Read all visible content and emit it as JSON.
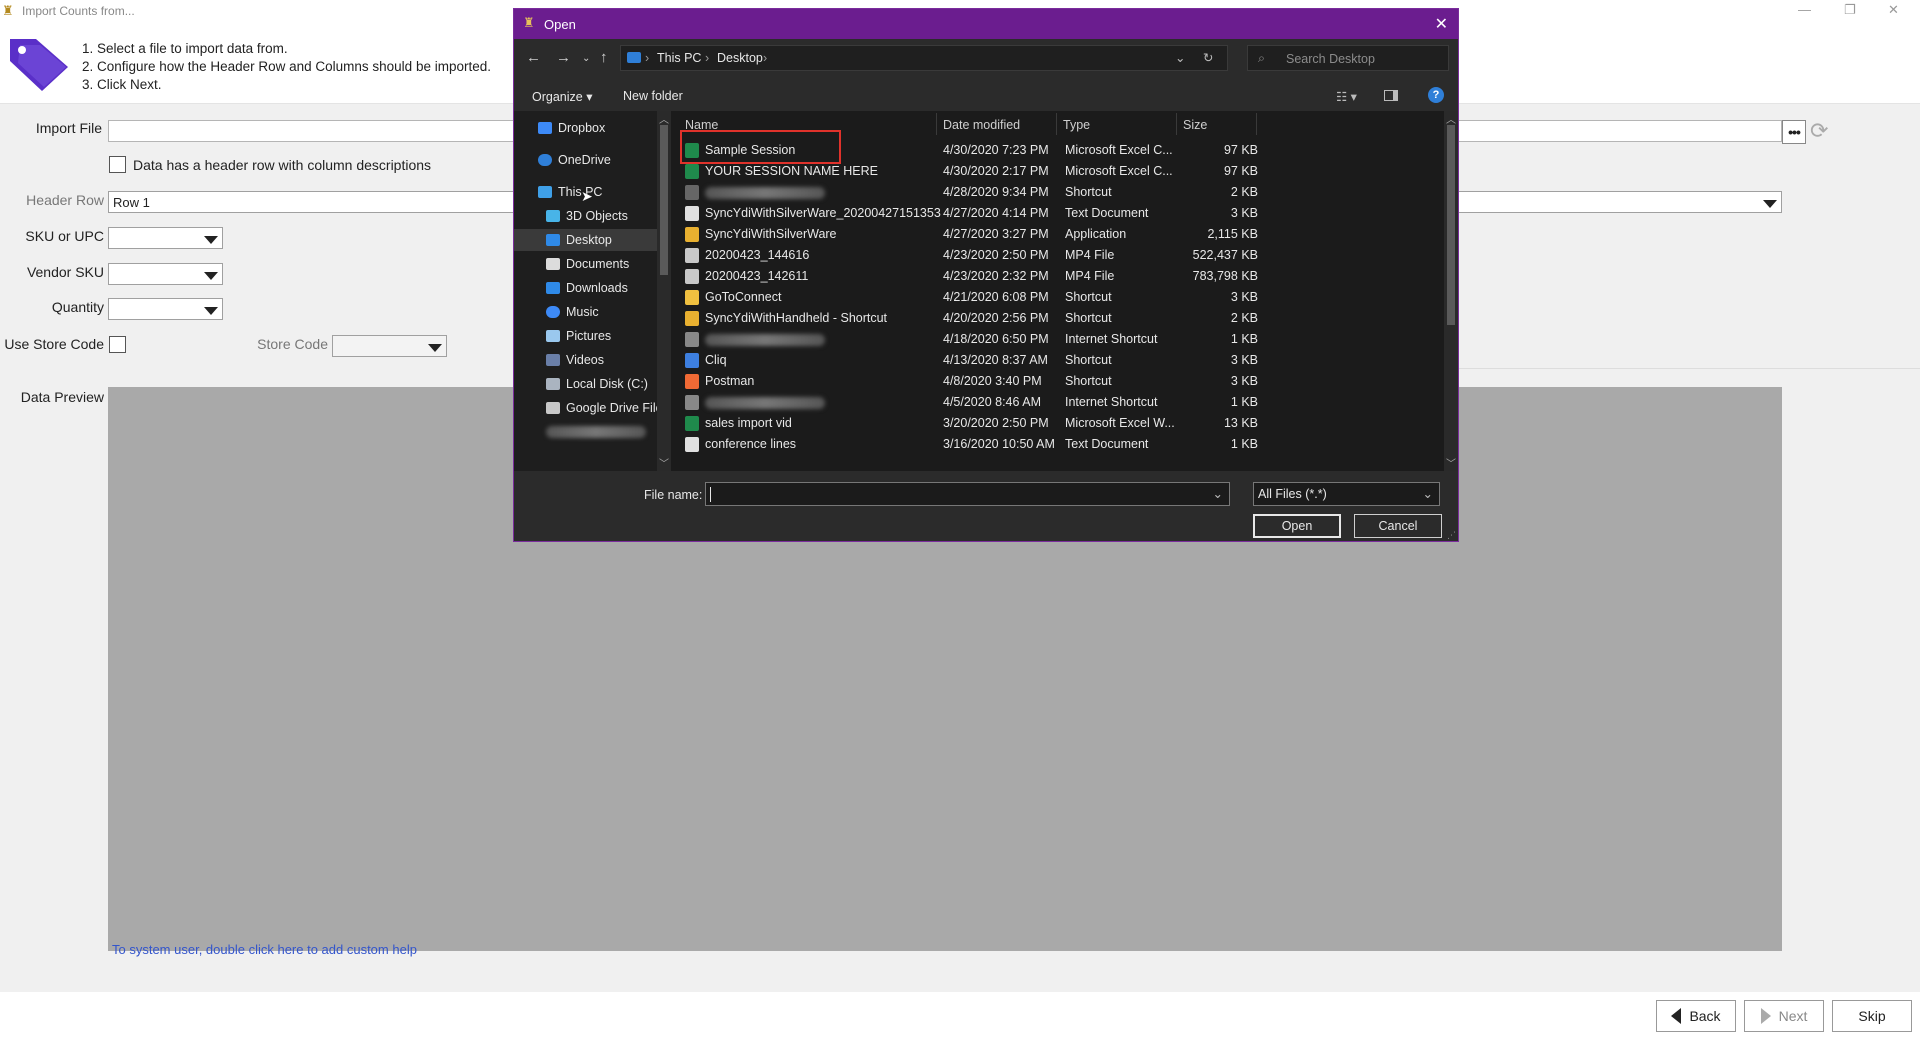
{
  "app": {
    "title": "Import Counts from...",
    "instructions": [
      "1. Select a file to import data from.",
      "2. Configure how the Header Row and Columns should be imported.",
      "3. Click Next."
    ],
    "labels": {
      "import_file": "Import File",
      "header_checkbox": "Data has a header row with column descriptions",
      "header_row": "Header Row",
      "sku_upc": "SKU or UPC",
      "vendor_sku": "Vendor SKU",
      "quantity": "Quantity",
      "use_store_code": "Use Store Code",
      "store_code": "Store Code",
      "data_preview": "Data Preview"
    },
    "header_row_value": "Row  1",
    "help_link": "To system user, double click here to add custom help",
    "buttons": {
      "back": "Back",
      "next": "Next",
      "skip": "Skip"
    }
  },
  "dialog": {
    "title": "Open",
    "breadcrumb": [
      "This PC",
      "Desktop"
    ],
    "search_placeholder": "Search Desktop",
    "toolbar": {
      "organize": "Organize",
      "new_folder": "New folder"
    },
    "nav_items": [
      "Dropbox",
      "OneDrive",
      "This PC",
      "3D Objects",
      "Desktop",
      "Documents",
      "Downloads",
      "Music",
      "Pictures",
      "Videos",
      "Local Disk (C:)",
      "Google Drive File"
    ],
    "columns": [
      "Name",
      "Date modified",
      "Type",
      "Size"
    ],
    "files": [
      {
        "name": "Sample Session",
        "date": "4/30/2020 7:23 PM",
        "type": "Microsoft Excel C...",
        "size": "97 KB",
        "icon": "excel-icon"
      },
      {
        "name": "YOUR SESSION NAME HERE",
        "date": "4/30/2020 2:17 PM",
        "type": "Microsoft Excel C...",
        "size": "97 KB",
        "icon": "excel-icon"
      },
      {
        "name": "",
        "date": "4/28/2020 9:34 PM",
        "type": "Shortcut",
        "size": "2 KB",
        "icon": "shortcut-icon"
      },
      {
        "name": "SyncYdiWithSilverWare_20200427151353",
        "date": "4/27/2020 4:14 PM",
        "type": "Text Document",
        "size": "3 KB",
        "icon": "text-file-icon"
      },
      {
        "name": "SyncYdiWithSilverWare",
        "date": "4/27/2020 3:27 PM",
        "type": "Application",
        "size": "2,115 KB",
        "icon": "app-icon"
      },
      {
        "name": "20200423_144616",
        "date": "4/23/2020 2:50 PM",
        "type": "MP4 File",
        "size": "522,437 KB",
        "icon": "video-file-icon"
      },
      {
        "name": "20200423_142611",
        "date": "4/23/2020 2:32 PM",
        "type": "MP4 File",
        "size": "783,798 KB",
        "icon": "video-file-icon"
      },
      {
        "name": "GoToConnect",
        "date": "4/21/2020 6:08 PM",
        "type": "Shortcut",
        "size": "3 KB",
        "icon": "gotoconnect-icon"
      },
      {
        "name": "SyncYdiWithHandheld - Shortcut",
        "date": "4/20/2020 2:56 PM",
        "type": "Shortcut",
        "size": "2 KB",
        "icon": "app-icon"
      },
      {
        "name": "",
        "date": "4/18/2020 6:50 PM",
        "type": "Internet Shortcut",
        "size": "1 KB",
        "icon": "internet-shortcut-icon"
      },
      {
        "name": "Cliq",
        "date": "4/13/2020 8:37 AM",
        "type": "Shortcut",
        "size": "3 KB",
        "icon": "cliq-icon"
      },
      {
        "name": "Postman",
        "date": "4/8/2020 3:40 PM",
        "type": "Shortcut",
        "size": "3 KB",
        "icon": "postman-icon"
      },
      {
        "name": "",
        "date": "4/5/2020 8:46 AM",
        "type": "Internet Shortcut",
        "size": "1 KB",
        "icon": "internet-shortcut-icon"
      },
      {
        "name": "sales import vid",
        "date": "3/20/2020 2:50 PM",
        "type": "Microsoft Excel W...",
        "size": "13 KB",
        "icon": "excel-icon"
      },
      {
        "name": "conference lines",
        "date": "3/16/2020 10:50 AM",
        "type": "Text Document",
        "size": "1 KB",
        "icon": "text-file-icon"
      }
    ],
    "file_name_label": "File name:",
    "file_name_value": "",
    "file_type": "All Files (*.*)",
    "buttons": {
      "open": "Open",
      "cancel": "Cancel"
    },
    "colors": {
      "titlebar": "#6b1d8f",
      "highlight": "#e0322b"
    }
  }
}
